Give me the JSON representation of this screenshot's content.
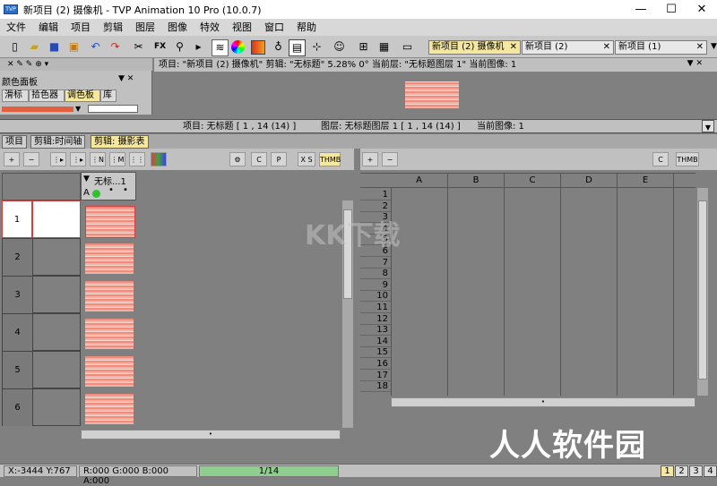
{
  "window": {
    "title": "新项目 (2) 摄像机 - TVP Animation 10 Pro (10.0.7)",
    "app_icon_text": "TVP",
    "buttons": [
      "—",
      "☐",
      "✕"
    ]
  },
  "menu": [
    "文件",
    "编辑",
    "项目",
    "剪辑",
    "图层",
    "图像",
    "特效",
    "视图",
    "窗口",
    "帮助"
  ],
  "toolbar": {
    "fx_label": "FX",
    "doc_tabs": [
      "新项目 (2) 摄像机",
      "新项目 (2)",
      "新项目 (1)"
    ],
    "close_glyph": "✕"
  },
  "left_panel": {
    "title": "颜色面板",
    "tabs": [
      "滑标",
      "拾色器",
      "调色板",
      "库"
    ],
    "active_tab": "调色板"
  },
  "preview": {
    "header": "项目: \"新项目 (2) 摄像机\"   剪辑: \"无标题\"   5.28%   0°   当前层: \"无标题图层 1\"   当前图像: 1"
  },
  "info_bar": {
    "project": "项目: 无标题 [ 1 , 14  (14) ]",
    "layer": "图层: 无标题图层 1 [ 1 , 14  (14) ]",
    "current": "当前图像: 1"
  },
  "tabs": [
    "项目",
    "剪辑:时间轴",
    "剪辑: 摄影表"
  ],
  "active_tab": "剪辑: 摄影表",
  "xsheet": {
    "layer_name": "无标...1",
    "layer_flags": "A",
    "rows": [
      "1",
      "2",
      "3",
      "4",
      "5",
      "6"
    ],
    "xs_label": "X S",
    "thmb_label": "THMB"
  },
  "grid": {
    "columns": [
      "A",
      "B",
      "C",
      "D",
      "E"
    ],
    "rows": [
      "1",
      "2",
      "3",
      "4",
      "5",
      "6",
      "7",
      "8",
      "9",
      "10",
      "11",
      "12",
      "13",
      "14",
      "15",
      "16",
      "17",
      "18"
    ],
    "thmb_label": "THMB"
  },
  "status": {
    "coords": "X:-3444  Y:767",
    "color": "R:000  G:000  B:000  A:000",
    "frame": "1/14",
    "pages": [
      "1",
      "2",
      "3",
      "4"
    ],
    "active_page": "1"
  },
  "watermark": "人人软件园",
  "watermark_mid": "KK下载",
  "colors": {
    "accent_yellow": "#f5e79e",
    "thumb_salmon": "#f08c7c",
    "status_green": "#8fce8f"
  }
}
